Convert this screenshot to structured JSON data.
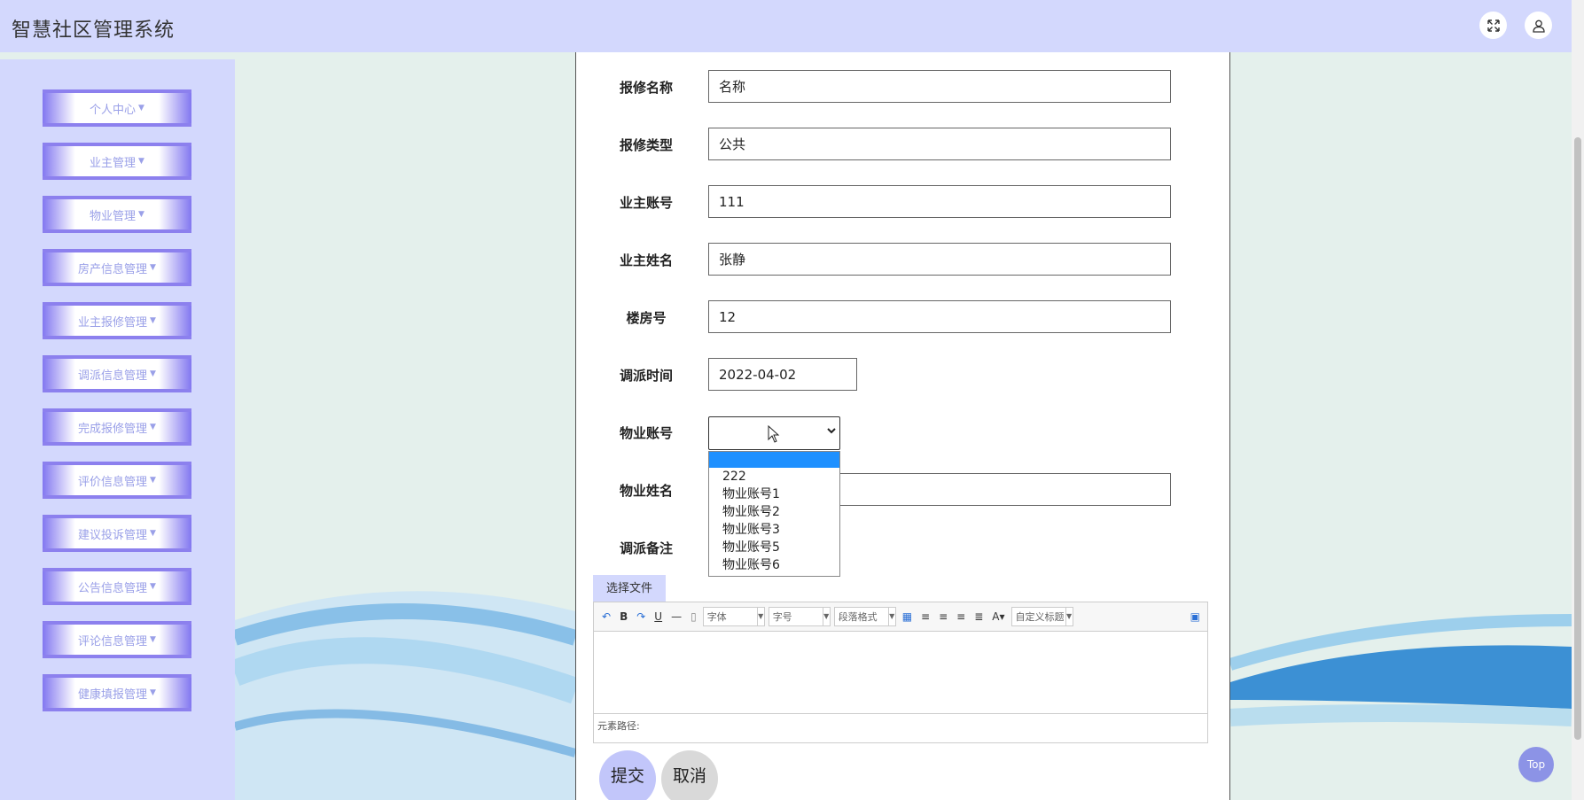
{
  "app": {
    "title": "智慧社区管理系统"
  },
  "sidebar": {
    "items": [
      {
        "label": "个人中心"
      },
      {
        "label": "业主管理"
      },
      {
        "label": "物业管理"
      },
      {
        "label": "房产信息管理"
      },
      {
        "label": "业主报修管理"
      },
      {
        "label": "调派信息管理"
      },
      {
        "label": "完成报修管理"
      },
      {
        "label": "评价信息管理"
      },
      {
        "label": "建议投诉管理"
      },
      {
        "label": "公告信息管理"
      },
      {
        "label": "评论信息管理"
      },
      {
        "label": "健康填报管理"
      }
    ]
  },
  "form": {
    "repair_name": {
      "label": "报修名称",
      "value": "名称"
    },
    "repair_type": {
      "label": "报修类型",
      "value": "公共"
    },
    "owner_account": {
      "label": "业主账号",
      "value": "111"
    },
    "owner_name": {
      "label": "业主姓名",
      "value": "张静"
    },
    "building_no": {
      "label": "楼房号",
      "value": "12"
    },
    "dispatch_time": {
      "label": "调派时间",
      "value": "2022-04-02"
    },
    "property_account": {
      "label": "物业账号",
      "value": "",
      "options": [
        "",
        "222",
        "物业账号1",
        "物业账号2",
        "物业账号3",
        "物业账号5",
        "物业账号6"
      ]
    },
    "property_name": {
      "label": "物业姓名",
      "value": ""
    },
    "dispatch_note": {
      "label": "调派备注"
    },
    "file_button": "选择文件",
    "editor": {
      "font_label": "字体",
      "size_label": "字号",
      "paragraph_label": "段落格式",
      "custom_label": "自定义标题",
      "status_text": "元素路径:"
    },
    "submit_label": "提交",
    "cancel_label": "取消"
  },
  "top_button": "Top"
}
